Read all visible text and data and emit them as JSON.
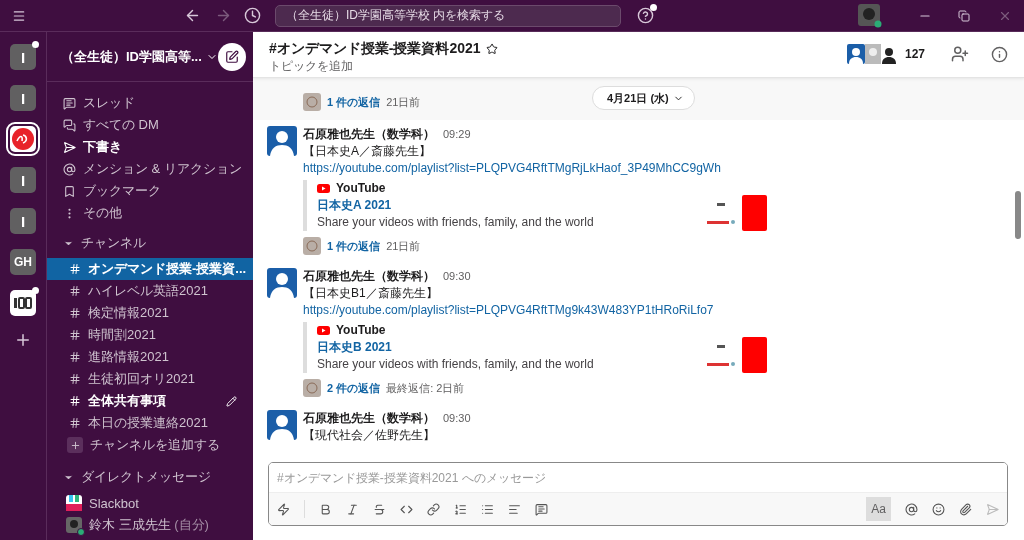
{
  "titlebar": {
    "search": "（全生徒）ID学園高等学校 内を検索する",
    "help_badge": true
  },
  "workspaces": [
    {
      "kind": "letter",
      "label": "I",
      "badge": true,
      "selected": false
    },
    {
      "kind": "letter",
      "label": "I",
      "badge": false,
      "selected": false
    },
    {
      "kind": "logo",
      "badge": false,
      "selected": true
    },
    {
      "kind": "letter",
      "label": "I",
      "badge": false,
      "selected": false
    },
    {
      "kind": "letter",
      "label": "I",
      "badge": false,
      "selected": false
    },
    {
      "kind": "letter",
      "label": "GH",
      "badge": false,
      "selected": false
    },
    {
      "kind": "mark",
      "badge": true,
      "selected": false
    },
    {
      "kind": "add"
    }
  ],
  "sidebar": {
    "workspace_name": "（全生徒）ID学園高等...",
    "nav": [
      {
        "kind": "threads",
        "label": "スレッド",
        "bold": false
      },
      {
        "kind": "dms",
        "label": "すべての DM",
        "bold": false
      },
      {
        "kind": "drafts",
        "label": "下書き",
        "bold": true
      },
      {
        "kind": "mentions",
        "label": "メンション & リアクション",
        "bold": false
      },
      {
        "kind": "bookmarks",
        "label": "ブックマーク",
        "bold": false
      },
      {
        "kind": "more",
        "label": "その他",
        "bold": false
      }
    ],
    "channels_header": "チャンネル",
    "channels": [
      {
        "name": "オンデマンド授業-授業資...",
        "selected": true,
        "bold": true,
        "draft": false
      },
      {
        "name": "ハイレベル英語2021",
        "selected": false,
        "bold": false,
        "draft": false
      },
      {
        "name": "検定情報2021",
        "selected": false,
        "bold": false,
        "draft": false
      },
      {
        "name": "時間割2021",
        "selected": false,
        "bold": false,
        "draft": false
      },
      {
        "name": "進路情報2021",
        "selected": false,
        "bold": false,
        "draft": false
      },
      {
        "name": "生徒初回オリ2021",
        "selected": false,
        "bold": false,
        "draft": false
      },
      {
        "name": "全体共有事項",
        "selected": false,
        "bold": true,
        "draft": true
      },
      {
        "name": "本日の授業連絡2021",
        "selected": false,
        "bold": false,
        "draft": false
      }
    ],
    "add_channel": "チャンネルを追加する",
    "dm_header": "ダイレクトメッセージ",
    "dms": [
      {
        "kind": "bot",
        "name": "Slackbot",
        "online": false
      },
      {
        "kind": "self",
        "name": "鈴木 三成先生",
        "suffix": "(自分)",
        "online": true
      }
    ]
  },
  "channel": {
    "title": "#オンデマンド授業-授業資料2021",
    "topic": "トピックを追加",
    "member_count": "127"
  },
  "date_pill": "4月21日 (水)",
  "messages": [
    {
      "highlighted": true,
      "replies": {
        "count": "1 件の返信",
        "meta": "21日前"
      }
    },
    {
      "highlighted": false,
      "author": "石原雅也先生（数学科）",
      "time": "09:29",
      "text": "【日本史A／斎藤先生】",
      "link": "https://youtube.com/playlist?list=PLQPVG4RftTMgRjLkHaof_3P49MhCC9gWh",
      "embed": {
        "source": "YouTube",
        "title": "日本史A 2021",
        "description": "Share your videos with friends, family, and the world"
      },
      "replies": {
        "count": "1 件の返信",
        "meta": "21日前"
      }
    },
    {
      "highlighted": false,
      "author": "石原雅也先生（数学科）",
      "time": "09:30",
      "text": "【日本史B1／斎藤先生】",
      "link": "https://youtube.com/playlist?list=PLQPVG4RftTMg9k43W483YP1tHRoRiLfo7",
      "embed": {
        "source": "YouTube",
        "title": "日本史B 2021",
        "description": "Share your videos with friends, family, and the world"
      },
      "replies": {
        "count": "2 件の返信",
        "meta": "最終返信: 2日前"
      }
    },
    {
      "highlighted": false,
      "author": "石原雅也先生（数学科）",
      "time": "09:30",
      "text": "【現代社会／佐野先生】"
    }
  ],
  "composer": {
    "placeholder": "#オンデマンド授業-授業資料2021 へのメッセージ",
    "format_button": "Aa"
  }
}
